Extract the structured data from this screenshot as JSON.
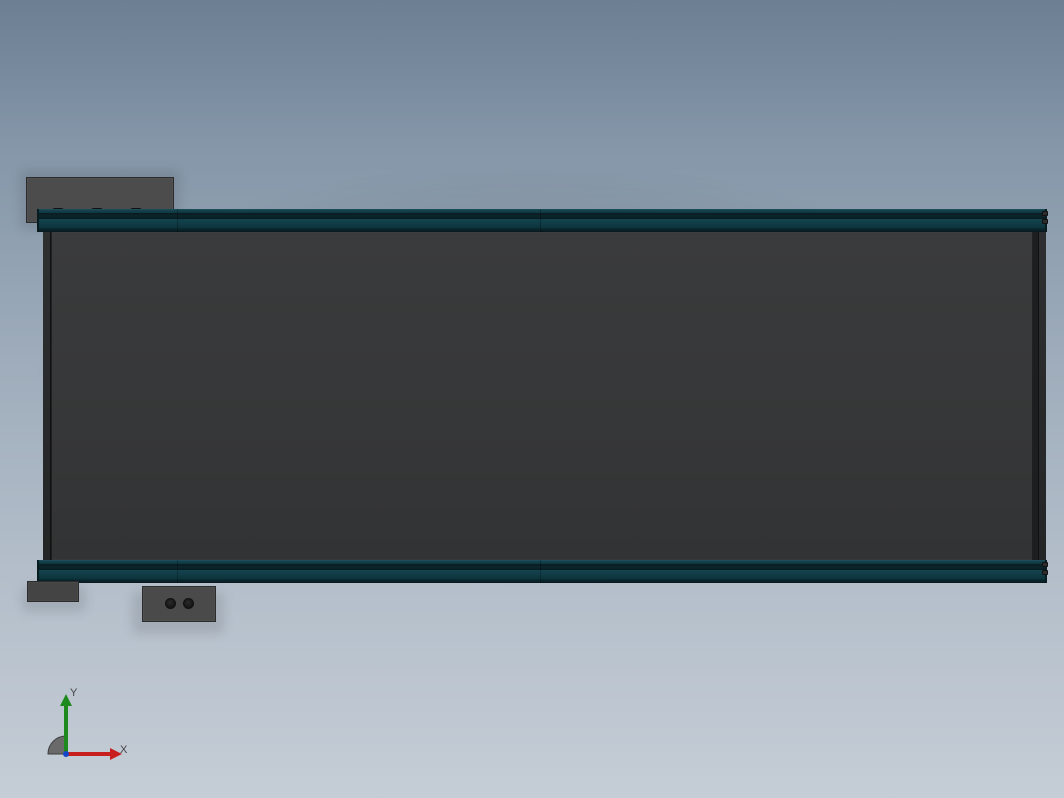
{
  "model": {
    "rail_color": "#124450",
    "belt_color": "#363738",
    "bracket_color": "#4c4c4c"
  },
  "triad": {
    "x_label": "X",
    "y_label": "Y",
    "x_color": "#c81e1e",
    "y_color": "#1e8a1e",
    "origin_color": "#6a6a6a"
  }
}
